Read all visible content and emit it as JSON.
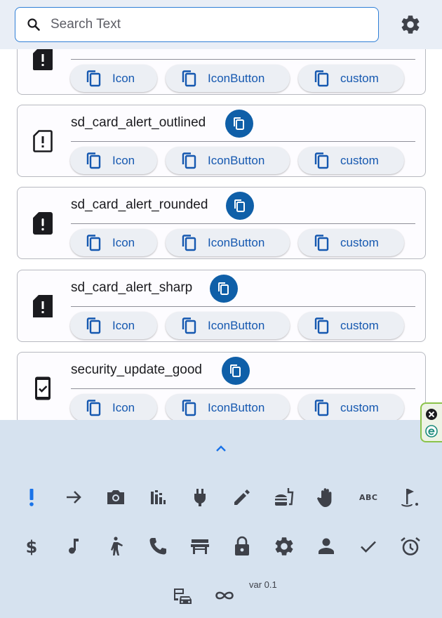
{
  "search": {
    "placeholder": "Search Text",
    "value": ""
  },
  "cards": [
    {
      "name": "",
      "icon": "sd-card-alert-filled-icon"
    },
    {
      "name": "sd_card_alert_outlined",
      "icon": "sd-card-alert-outlined-icon"
    },
    {
      "name": "sd_card_alert_rounded",
      "icon": "sd-card-alert-rounded-icon"
    },
    {
      "name": "sd_card_alert_sharp",
      "icon": "sd-card-alert-sharp-icon"
    },
    {
      "name": "security_update_good",
      "icon": "security-update-good-icon"
    }
  ],
  "chips": {
    "icon": "Icon",
    "iconbutton": "IconButton",
    "custom": "custom"
  },
  "categories": [
    "priority-high-icon",
    "arrow-forward-icon",
    "camera-icon",
    "chart-icon",
    "plug-icon",
    "pencil-icon",
    "fastfood-icon",
    "hand-icon",
    "abc-icon",
    "golf-icon",
    "dollar-icon",
    "music-note-icon",
    "person-pointing-icon",
    "phone-icon",
    "bench-icon",
    "lock-icon",
    "settings-icon",
    "person-icon",
    "check-icon",
    "alarm-icon",
    "commute-icon",
    "infinity-icon"
  ],
  "abc_label": "ABC",
  "version": "var 0.1",
  "colors": {
    "accent": "#0f5fa8",
    "chip_text": "#1558b0",
    "panel": "#d6e2ef",
    "selected": "#1a73e8"
  }
}
